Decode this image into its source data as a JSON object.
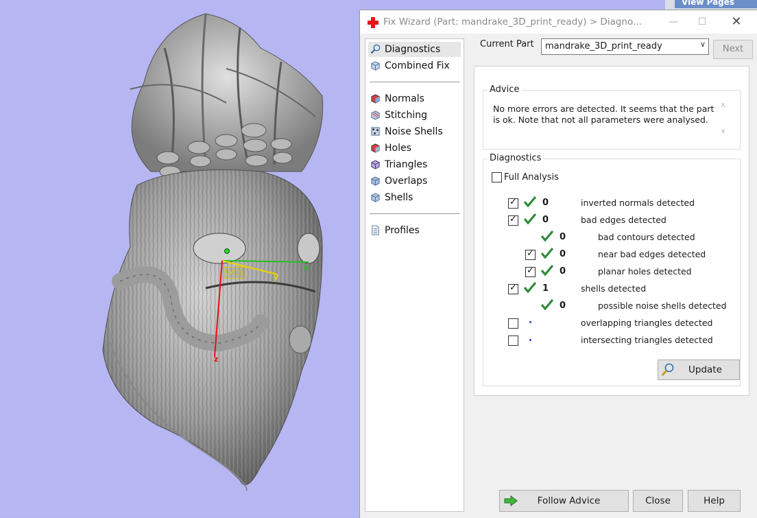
{
  "viewport": {
    "wcs_label": "WCS",
    "axis_x": "x",
    "axis_y": "y",
    "axis_z": "z"
  },
  "background_app": {
    "view_pages": "View Pages"
  },
  "dialog": {
    "title": "Fix Wizard (Part: mandrake_3D_print_ready) > Diagno...",
    "nav": {
      "group1": [
        {
          "label": "Diagnostics",
          "icon": "magnifier-icon",
          "selected": true
        },
        {
          "label": "Combined Fix",
          "icon": "cube-icon"
        }
      ],
      "group2": [
        {
          "label": "Normals",
          "icon": "normals-icon"
        },
        {
          "label": "Stitching",
          "icon": "stitching-icon"
        },
        {
          "label": "Noise Shells",
          "icon": "noise-shells-icon"
        },
        {
          "label": "Holes",
          "icon": "holes-icon"
        },
        {
          "label": "Triangles",
          "icon": "triangles-icon"
        },
        {
          "label": "Overlaps",
          "icon": "overlaps-icon"
        },
        {
          "label": "Shells",
          "icon": "shells-icon"
        }
      ],
      "group3": [
        {
          "label": "Profiles",
          "icon": "document-icon"
        }
      ]
    },
    "current_part_label": "Current Part",
    "current_part_value": "mandrake_3D_print_ready",
    "next_label": "Next",
    "advice": {
      "title": "Advice",
      "text": "No more errors are detected. It seems that the part is ok. Note that not all parameters were analysed."
    },
    "diagnostics": {
      "title": "Diagnostics",
      "full_analysis_label": "Full Analysis",
      "full_analysis_checked": false,
      "rows": [
        {
          "checkbox": true,
          "checked": true,
          "status": "ok",
          "count": "0",
          "label": "inverted normals detected",
          "indent": 0
        },
        {
          "checkbox": true,
          "checked": true,
          "status": "ok",
          "count": "0",
          "label": "bad edges detected",
          "indent": 0
        },
        {
          "checkbox": false,
          "checked": false,
          "status": "ok",
          "count": "0",
          "label": "bad contours detected",
          "indent": 1
        },
        {
          "checkbox": true,
          "checked": true,
          "status": "ok",
          "count": "0",
          "label": "near bad edges detected",
          "indent": 1
        },
        {
          "checkbox": true,
          "checked": true,
          "status": "ok",
          "count": "0",
          "label": "planar holes detected",
          "indent": 1
        },
        {
          "checkbox": true,
          "checked": true,
          "status": "ok",
          "count": "1",
          "label": "shells detected",
          "indent": 0
        },
        {
          "checkbox": false,
          "checked": false,
          "status": "ok",
          "count": "0",
          "label": "possible noise shells detected",
          "indent": 1
        },
        {
          "checkbox": true,
          "checked": false,
          "status": "pending",
          "count": "",
          "label": "overlapping triangles detected",
          "indent": 0
        },
        {
          "checkbox": true,
          "checked": false,
          "status": "pending",
          "count": "",
          "label": "intersecting triangles detected",
          "indent": 0
        }
      ],
      "update_label": "Update"
    },
    "buttons": {
      "follow_advice": "Follow Advice",
      "close": "Close",
      "help": "Help"
    },
    "colors": {
      "ok_check": "#2e8b3a",
      "pending_dot": "#1e3fd0",
      "app_icon": "#e8141c"
    }
  }
}
